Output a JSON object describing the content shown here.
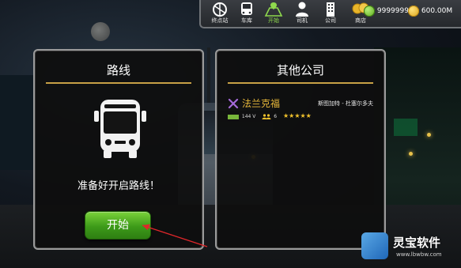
{
  "topbar": {
    "nav": [
      {
        "label": "终点站",
        "icon": "terminal-icon",
        "active": false
      },
      {
        "label": "车库",
        "icon": "garage-icon",
        "active": false
      },
      {
        "label": "开始",
        "icon": "start-map-icon",
        "active": true
      },
      {
        "label": "司机",
        "icon": "driver-icon",
        "active": false
      },
      {
        "label": "公司",
        "icon": "company-icon",
        "active": false
      },
      {
        "label": "商店",
        "icon": "shop-icon",
        "active": false
      }
    ],
    "coins": "99999999",
    "money": "600.00M"
  },
  "route_panel": {
    "title": "路线",
    "message": "准备好开启路线！",
    "start_label": "开始"
  },
  "company_panel": {
    "title": "其他公司",
    "company": {
      "name": "法兰克福",
      "route": "斯图加特 - 杜塞尔多夫",
      "level": "144 V",
      "drivers": "6",
      "stars": "★★★★★"
    }
  },
  "watermark": {
    "name": "灵宝软件",
    "url": "www.lbwbw.com"
  },
  "colors": {
    "accent_gold": "#c8a146",
    "start_green": "#3d9a19",
    "active_tab": "#8fd94d"
  }
}
